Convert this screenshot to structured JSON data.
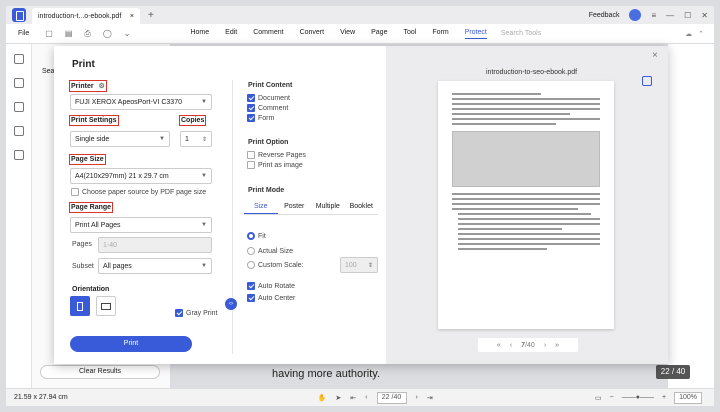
{
  "titlebar": {
    "tab_title": "introduction-t...o-ebook.pdf",
    "tab_close": "×",
    "new_tab": "+",
    "feedback": "Feedback"
  },
  "menubar": {
    "file": "File",
    "items": [
      "Home",
      "Edit",
      "Comment",
      "Convert",
      "View",
      "Page",
      "Tool",
      "Form",
      "Protect"
    ],
    "active": "Protect",
    "search_placeholder": "Search Tools"
  },
  "sidebar": {
    "clear_results": "Clear Results",
    "search_label": "Sea"
  },
  "background": {
    "doc_text": "having more authority.",
    "page_badge": "22 / 40"
  },
  "statusbar": {
    "dimensions": "21.59 x 27.94 cm",
    "page_input": "22 /40",
    "zoom": "100%"
  },
  "dialog": {
    "title": "Print",
    "close": "×",
    "printer": {
      "label": "Printer",
      "value": "FUJI XEROX ApeosPort-VI C3370"
    },
    "print_settings": {
      "label": "Print Settings",
      "value": "Single side"
    },
    "copies": {
      "label": "Copies",
      "value": "1"
    },
    "page_size": {
      "label": "Page Size",
      "value": "A4(210x297mm) 21 x 29.7 cm",
      "choose_by_pdf": "Choose paper source by PDF page size"
    },
    "page_range": {
      "label": "Page Range",
      "value": "Print All Pages",
      "pages_label": "Pages",
      "pages_placeholder": "1-40",
      "subset_label": "Subset",
      "subset_value": "All pages"
    },
    "orientation": {
      "label": "Orientation"
    },
    "gray_print": "Gray Print",
    "print_button": "Print",
    "collapse": "‹›",
    "print_content": {
      "title": "Print Content",
      "items": [
        {
          "label": "Document",
          "checked": true
        },
        {
          "label": "Comment",
          "checked": true
        },
        {
          "label": "Form",
          "checked": true
        }
      ]
    },
    "print_option": {
      "title": "Print Option",
      "items": [
        {
          "label": "Reverse Pages",
          "checked": false
        },
        {
          "label": "Print as image",
          "checked": false
        }
      ]
    },
    "print_mode": {
      "title": "Print Mode",
      "tabs": [
        "Size",
        "Poster",
        "Multiple",
        "Booklet"
      ],
      "active": "Size"
    },
    "size_options": [
      {
        "label": "Fit",
        "selected": true
      },
      {
        "label": "Actual Size",
        "selected": false
      },
      {
        "label": "Custom Scale:",
        "selected": false
      }
    ],
    "custom_scale_value": "100",
    "auto_options": [
      {
        "label": "Auto Rotate",
        "checked": true
      },
      {
        "label": "Auto Center",
        "checked": true
      }
    ],
    "preview": {
      "filename": "introduction-to-seo-ebook.pdf",
      "current_page": "7",
      "total": "/40"
    }
  },
  "colors": {
    "accent": "#3a5bd9",
    "highlight": "#d9342b"
  }
}
